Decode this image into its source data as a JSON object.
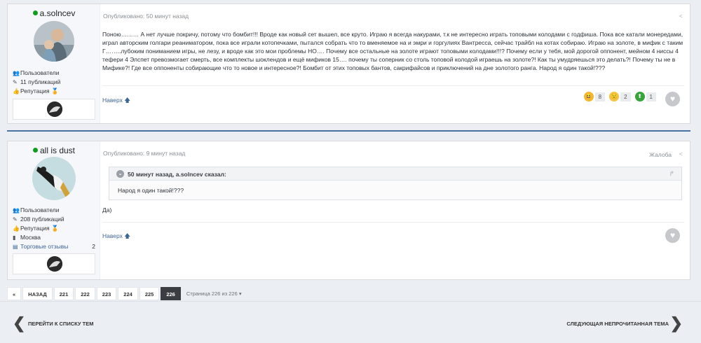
{
  "posts": [
    {
      "author": "a.solncev",
      "group": "Пользователи",
      "posts_count": "11 публикаций",
      "reputation_label": "Репутация",
      "published": "Опубликовано: 50 минут назад",
      "body": "Поною……… А нет лучше покричу, потому что бомбит!!! Вроде как новый сет вышел, все круто. Играю я всегда накурами, т.к не интересно играть топовыми колодами с годфиша. Пока все катали монередами, играл авторским голгари реаниматором, пока все играли котопечками, пытался собрать что то вменяемое на и эмри и горгулиях Вантресса, сейчас трайбл на котах собираю. Играю на золоте, в мифик с таким Г……..лубоким пониманием игры, не лезу, и вроде как  это мои проблемы НО…. Почему все остальные на золоте играют топовыми колодами!!!? Почему если у тебя, мой дорогой оппонент, мейном 4 ниссы 4 тефери 4 Элспет превозмогает смерть, все комплекты шоклендов и ещё мификов 15…. почему ты соперник со столь топовой колодой играешь на золоте?! Как ты умудряешься это делать?! Почему ты не в Мифике?! Где все оппоненты собирающие что то новое и интересное?! Бомбит от этих топовых бантов, сакрифайсов и приключений на дне золотого ранга. Народ я один такой!???",
      "top_link": "Наверх",
      "reactions": [
        {
          "emoji": "laugh-icon",
          "count": "8",
          "color": "#f4b733"
        },
        {
          "emoji": "sad-icon",
          "count": "2",
          "color": "#f4c542"
        },
        {
          "emoji": "upvote-icon",
          "count": "1",
          "color": "#36a33b"
        }
      ]
    },
    {
      "author": "all is dust",
      "group": "Пользователи",
      "posts_count": "208 публикаций",
      "reputation_label": "Репутация",
      "city": "Москва",
      "trade_label": "Торговые отзывы",
      "trade_count": "2",
      "published": "Опубликовано: 9 минут назад",
      "report": "Жалоба",
      "quote_header": "50 минут назад, a.solncev сказал:",
      "quote_body": "Народ я один такой!???",
      "body": "Да)",
      "top_link": "Наверх"
    }
  ],
  "pagination": {
    "first": "«",
    "prev": "НАЗАД",
    "pages": [
      "221",
      "222",
      "223",
      "224",
      "225",
      "226"
    ],
    "page_info": "Страница 226 из 226"
  },
  "nav": {
    "back": "ПЕРЕЙТИ К СПИСКУ ТЕМ",
    "next": "СЛЕДУЮЩАЯ НЕПРОЧИТАННАЯ ТЕМА"
  },
  "colors": {
    "online": "#0f9d1f",
    "link": "#3d6594",
    "accent": "#4a73a3"
  }
}
